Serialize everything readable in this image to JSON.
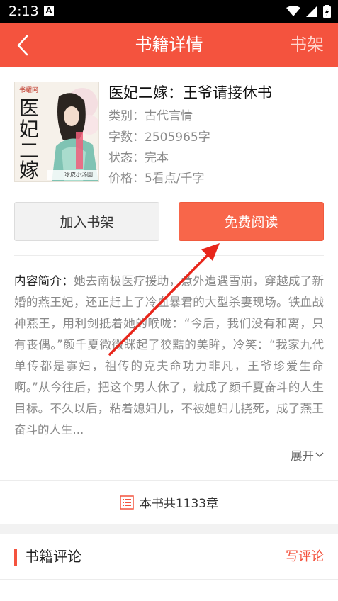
{
  "status_bar": {
    "time": "2:13",
    "notif": "A"
  },
  "header": {
    "title": "书籍详情",
    "shelf_link": "书架"
  },
  "book": {
    "title": "医妃二嫁：王爷请接休书",
    "category": "类别：古代言情",
    "word_count": "字数：2505965字",
    "status": "状态：完本",
    "price": "价格：5看点/千字",
    "cover": {
      "publisher": "书耀网",
      "title_chars": [
        "医",
        "妃",
        "二",
        "嫁"
      ],
      "author": "冰皮小汤圆"
    }
  },
  "actions": {
    "add_shelf": "加入书架",
    "read_free": "免费阅读"
  },
  "intro": {
    "label": "内容简介：",
    "text": "她去南极医疗援助，意外遭遇雪崩，穿越成了新婚的燕王妃，还正赶上了冷血暴君的大型杀妻现场。铁血战神燕王，用利剑抵着她的喉咙：“今后，我们没有和离，只有丧偶。”颜千夏微微眯起了狡黠的美眸，冷笑：“我家九代单传都是寡妇，祖传的克夫命功力非凡，王爷珍爱生命啊。”从今往后，把这个男人休了，就成了颜千夏奋斗的人生目标。不久以后，粘着媳妇儿，不被媳妇儿挠死，成了燕王奋斗的人生...",
    "expand": "展开"
  },
  "chapters": {
    "label": "本书共1133章"
  },
  "reviews": {
    "title": "书籍评论",
    "write": "写评论"
  },
  "colors": {
    "accent": "#f4533e",
    "read_button": "#f8664a"
  }
}
